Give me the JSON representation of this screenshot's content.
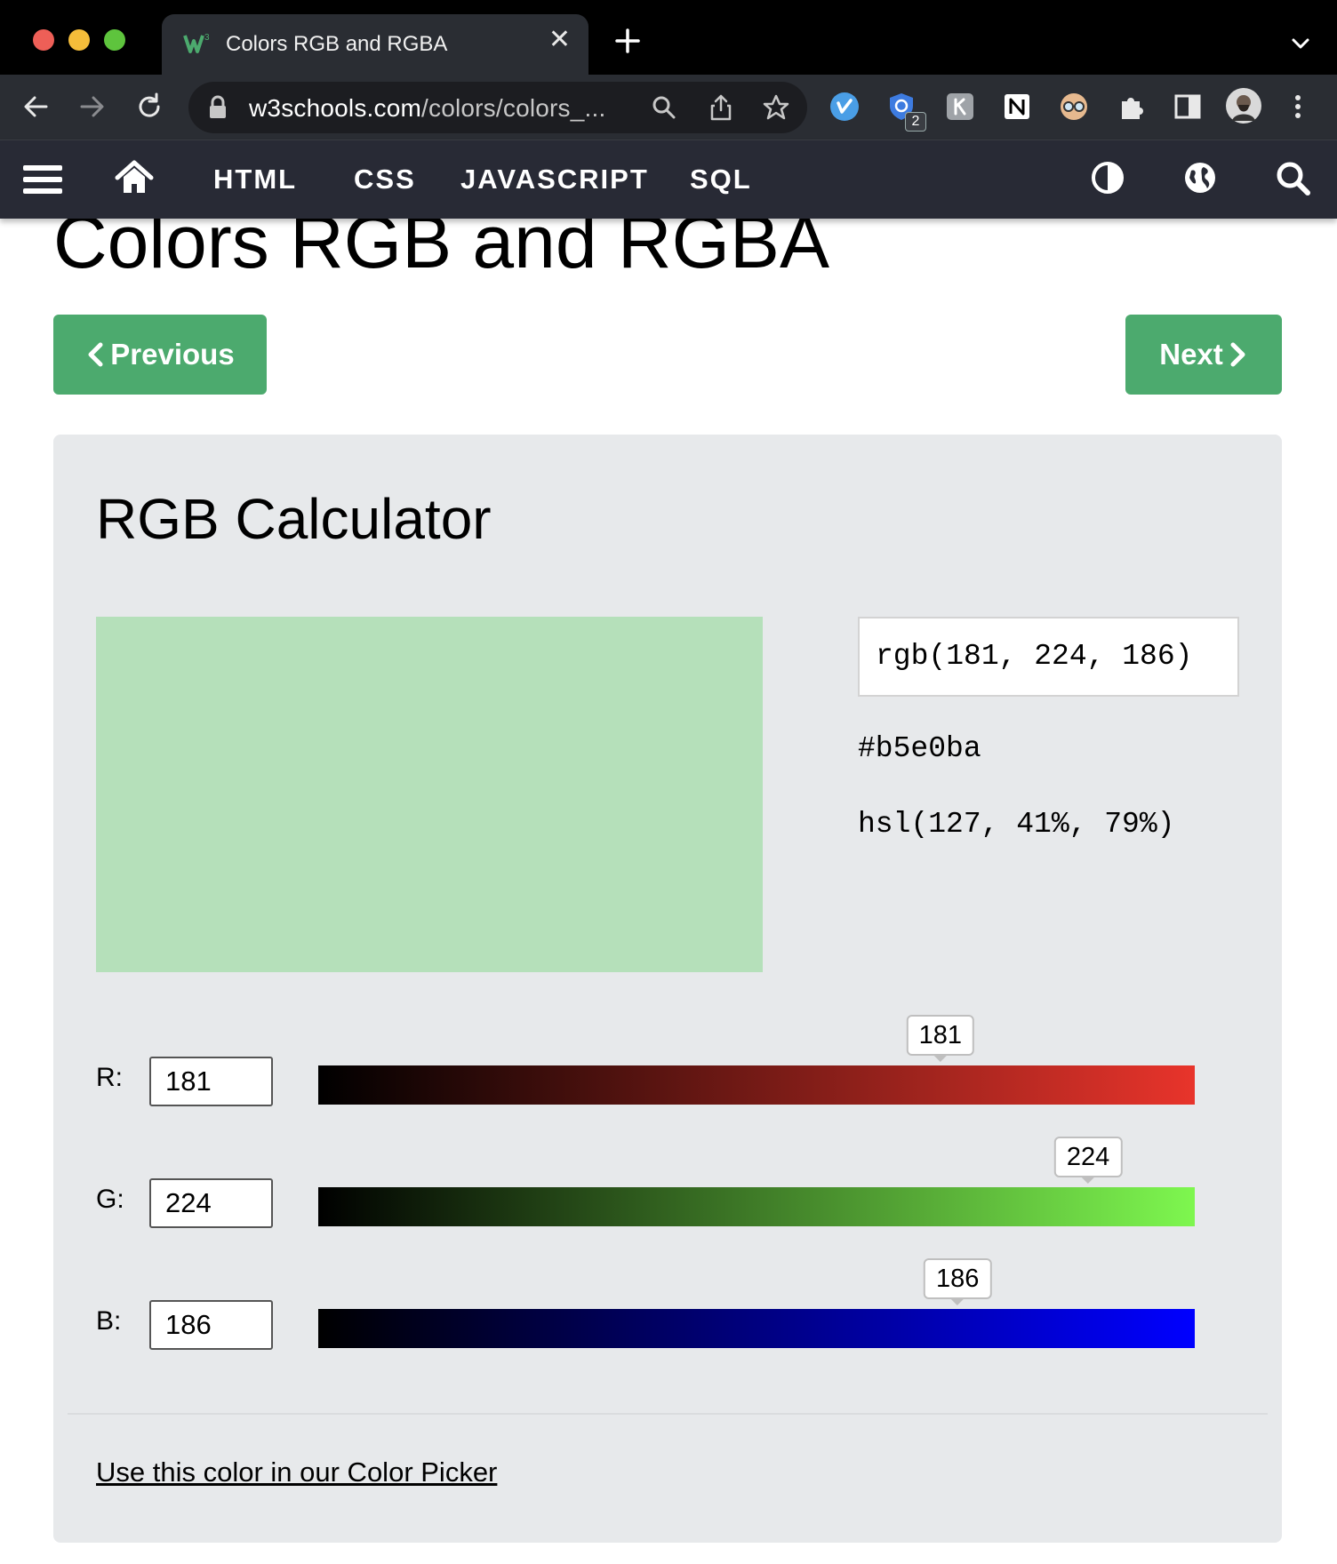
{
  "browser": {
    "tab_title": "Colors RGB and RGBA",
    "url_host": "w3schools.com",
    "url_path": "/colors/colors_...",
    "extension_badge": "2"
  },
  "nav": {
    "links": [
      "HTML",
      "CSS",
      "JAVASCRIPT",
      "SQL"
    ]
  },
  "page": {
    "title": "Colors RGB and RGBA",
    "prev_label": "Previous",
    "next_label": "Next"
  },
  "calculator": {
    "title": "RGB Calculator",
    "rgb_string": "rgb(181, 224, 186)",
    "hex_string": "#b5e0ba",
    "hsl_string": "hsl(127, 41%, 79%)",
    "swatch_color": "#b5e0ba",
    "channels": [
      {
        "label": "R:",
        "value": "181",
        "level": 181,
        "max": 255,
        "color": "#e8342b"
      },
      {
        "label": "G:",
        "value": "224",
        "level": 224,
        "max": 255,
        "color": "#7ef74f"
      },
      {
        "label": "B:",
        "value": "186",
        "level": 186,
        "max": 255,
        "color": "#0000ff"
      }
    ],
    "picker_link": "Use this color in our Color Picker"
  },
  "colors": {
    "brand_green": "#4caa6e",
    "nav_bg": "#282a35",
    "panel_bg": "#e7e9eb"
  }
}
